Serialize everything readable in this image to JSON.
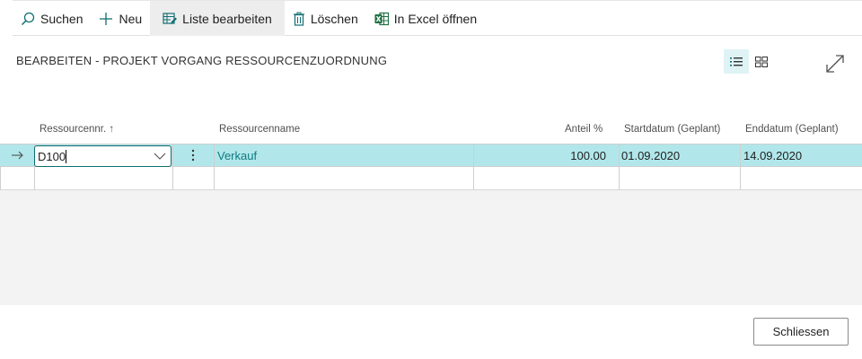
{
  "toolbar": {
    "search": "Suchen",
    "new": "Neu",
    "edit_list": "Liste bearbeiten",
    "delete": "Löschen",
    "open_excel": "In Excel öffnen"
  },
  "page": {
    "title": "BEARBEITEN - PROJEKT VORGANG RESSOURCENZUORDNUNG"
  },
  "table": {
    "columns": {
      "resource_no": "Ressourcennr. ↑",
      "resource_name": "Ressourcenname",
      "share": "Anteil %",
      "start_date": "Startdatum (Geplant)",
      "end_date": "Enddatum (Geplant)"
    },
    "rows": [
      {
        "resource_no": "D100",
        "resource_name": "Verkauf",
        "share": "100.00",
        "start_date": "01.09.2020",
        "end_date": "14.09.2020"
      }
    ]
  },
  "footer": {
    "close": "Schliessen"
  },
  "colors": {
    "accent": "#106e74",
    "selected_row": "#b1e7ea",
    "link": "#107a80"
  }
}
